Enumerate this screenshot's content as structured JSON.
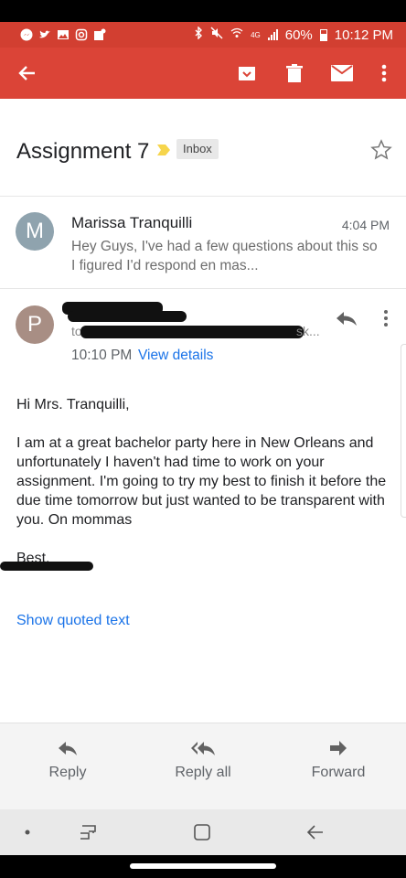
{
  "status_bar": {
    "battery": "60%",
    "time": "10:12 PM",
    "network": "4G"
  },
  "app_bar": {
    "back_icon": "arrow-left-icon",
    "archive_icon": "archive-icon",
    "delete_icon": "trash-icon",
    "mark_unread_icon": "mail-icon",
    "more_icon": "more-vert-icon"
  },
  "thread": {
    "subject": "Assignment 7",
    "label_chip": "Inbox"
  },
  "message1": {
    "avatar_letter": "M",
    "sender": "Marissa Tranquilli",
    "time": "4:04 PM",
    "snippet": "Hey Guys, I've had a few questions about this so I figured I'd respond en mas..."
  },
  "message2": {
    "avatar_letter": "P",
    "to_prefix": "to",
    "to_suffix": "sk...",
    "time": "10:10 PM",
    "view_details": "View details",
    "greeting": "Hi Mrs. Tranquilli,",
    "paragraph": "I am at a great bachelor party here in New Orleans and unfortunately I haven't had time to work on your assignment. I'm going to try my best to finish it before the due time tomorrow but just wanted to be transparent with you. On mommas",
    "signoff": "Best,",
    "show_quoted": "Show quoted text"
  },
  "actions": {
    "reply": "Reply",
    "reply_all": "Reply all",
    "forward": "Forward"
  },
  "colors": {
    "status_bar": "#d23f31",
    "app_bar": "#db4437",
    "link": "#1a73e8"
  }
}
